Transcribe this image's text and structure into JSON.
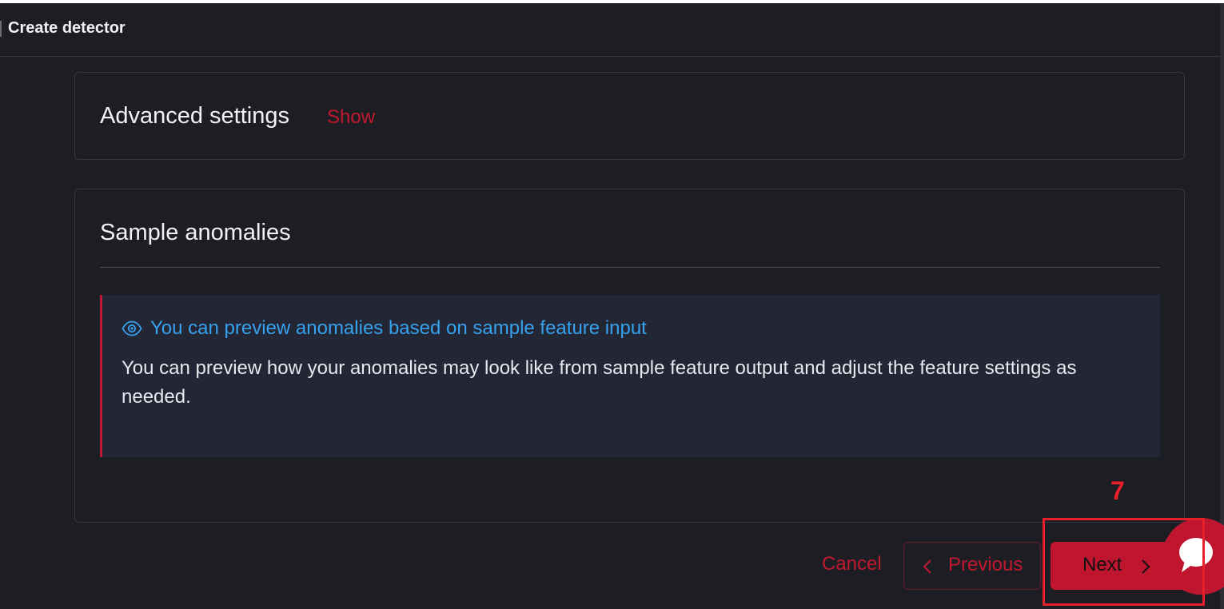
{
  "header": {
    "title": "Create detector"
  },
  "advanced": {
    "title": "Advanced settings",
    "toggle_label": "Show"
  },
  "sample": {
    "title": "Sample anomalies",
    "callout": {
      "icon": "eye-icon",
      "title": "You can preview anomalies based on sample feature input",
      "body": "You can preview how your anomalies may look like from sample feature output and adjust the feature settings as needed."
    }
  },
  "footer": {
    "cancel_label": "Cancel",
    "previous_label": "Previous",
    "next_label": "Next"
  },
  "annotation": {
    "number": "7"
  },
  "colors": {
    "accent": "#c0152f",
    "info_text": "#36a2ef",
    "background": "#1d1e24",
    "callout_bg": "#232635",
    "annotation": "#e8202a"
  }
}
